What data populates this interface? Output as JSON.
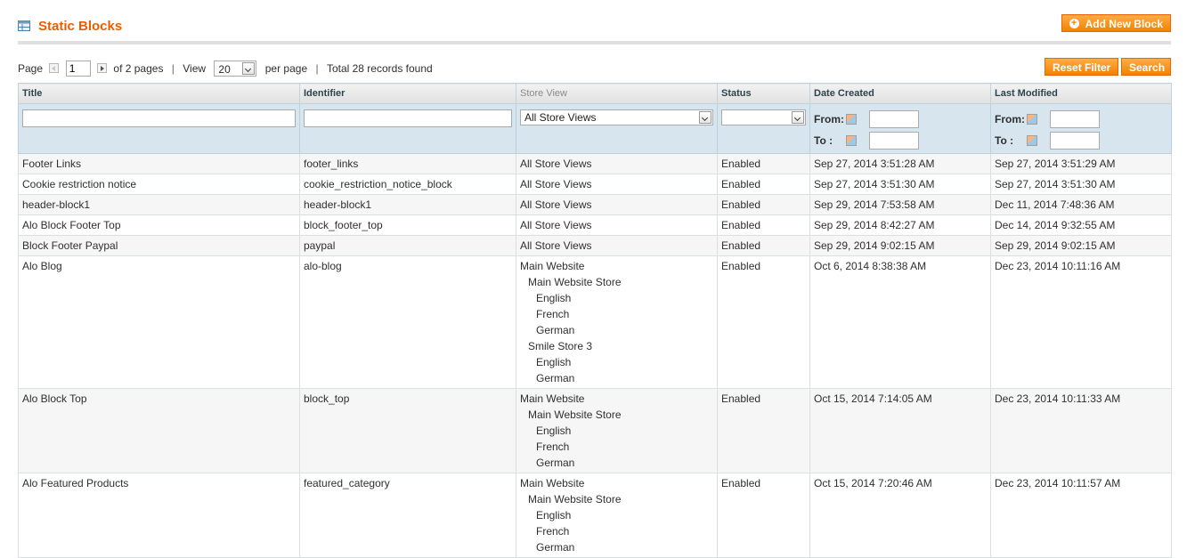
{
  "header": {
    "title": "Static Blocks",
    "add_button": "Add New Block"
  },
  "pager": {
    "page_label": "Page",
    "page_value": "1",
    "of_pages": "of 2 pages",
    "separator": "|",
    "view_label": "View",
    "per_page_value": "20",
    "per_page_label": "per page",
    "total": "Total 28 records found"
  },
  "actions": {
    "reset": "Reset Filter",
    "search": "Search"
  },
  "columns": [
    "Title",
    "Identifier",
    "Store View",
    "Status",
    "Date Created",
    "Last Modified"
  ],
  "filters": {
    "store_view": "All Store Views",
    "from_label": "From:",
    "to_label": "To :"
  },
  "rows": [
    {
      "title": "Footer Links",
      "identifier": "footer_links",
      "store": [
        "All Store Views"
      ],
      "status": "Enabled",
      "created": "Sep 27, 2014 3:51:28 AM",
      "modified": "Sep 27, 2014 3:51:29 AM"
    },
    {
      "title": "Cookie restriction notice",
      "identifier": "cookie_restriction_notice_block",
      "store": [
        "All Store Views"
      ],
      "status": "Enabled",
      "created": "Sep 27, 2014 3:51:30 AM",
      "modified": "Sep 27, 2014 3:51:30 AM"
    },
    {
      "title": "header-block1",
      "identifier": "header-block1",
      "store": [
        "All Store Views"
      ],
      "status": "Enabled",
      "created": "Sep 29, 2014 7:53:58 AM",
      "modified": "Dec 11, 2014 7:48:36 AM"
    },
    {
      "title": "Alo Block Footer Top",
      "identifier": "block_footer_top",
      "store": [
        "All Store Views"
      ],
      "status": "Enabled",
      "created": "Sep 29, 2014 8:42:27 AM",
      "modified": "Dec 14, 2014 9:32:55 AM"
    },
    {
      "title": "Block Footer Paypal",
      "identifier": "paypal",
      "store": [
        "All Store Views"
      ],
      "status": "Enabled",
      "created": "Sep 29, 2014 9:02:15 AM",
      "modified": "Sep 29, 2014 9:02:15 AM"
    },
    {
      "title": "Alo Blog",
      "identifier": "alo-blog",
      "store": [
        "Main Website",
        "Main Website Store",
        "English",
        "French",
        "German",
        "Smile Store 3",
        "English",
        "German"
      ],
      "status": "Enabled",
      "created": "Oct 6, 2014 8:38:38 AM",
      "modified": "Dec 23, 2014 10:11:16 AM"
    },
    {
      "title": "Alo Block Top",
      "identifier": "block_top",
      "store": [
        "Main Website",
        "Main Website Store",
        "English",
        "French",
        "German"
      ],
      "status": "Enabled",
      "created": "Oct 15, 2014 7:14:05 AM",
      "modified": "Dec 23, 2014 10:11:33 AM"
    },
    {
      "title": "Alo Featured Products",
      "identifier": "featured_category",
      "store": [
        "Main Website",
        "Main Website Store",
        "English",
        "French",
        "German"
      ],
      "status": "Enabled",
      "created": "Oct 15, 2014 7:20:46 AM",
      "modified": "Dec 23, 2014 10:11:57 AM"
    }
  ]
}
